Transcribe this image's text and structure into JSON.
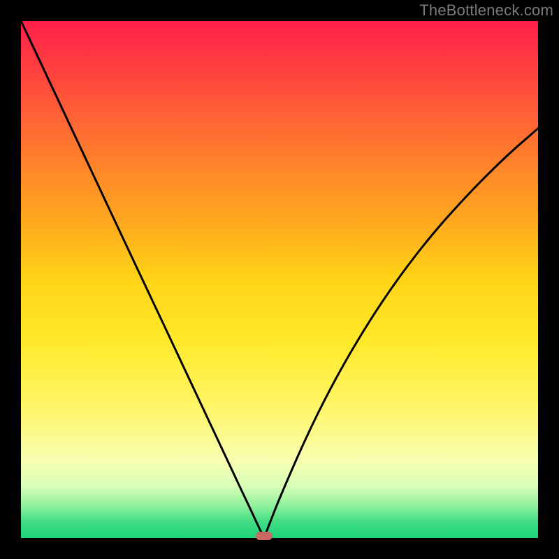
{
  "watermark": "TheBottleneck.com",
  "colors": {
    "frame": "#000000",
    "watermark": "#7b7b7b",
    "curve": "#000000",
    "marker": "#c96a64",
    "gradient_stops": [
      "#ff1f4a",
      "#ff4a3c",
      "#ff7a2e",
      "#ffa61f",
      "#ffd417",
      "#ffe92a",
      "#fff66a",
      "#f8ffb0",
      "#d8ffb8",
      "#8aef9a",
      "#3fdc84",
      "#1dd57a"
    ]
  },
  "chart_data": {
    "type": "line",
    "title": "",
    "xlabel": "",
    "ylabel": "",
    "xlim": [
      0,
      100
    ],
    "ylim": [
      0,
      100
    ],
    "x": [
      0,
      5,
      10,
      15,
      20,
      25,
      30,
      35,
      40,
      42,
      44,
      46,
      47,
      48,
      50,
      55,
      60,
      65,
      70,
      75,
      80,
      85,
      90,
      95,
      100
    ],
    "y": [
      100,
      89.4,
      78.7,
      68.1,
      57.4,
      46.8,
      36.2,
      25.5,
      14.9,
      10.6,
      6.4,
      2.1,
      0,
      2.6,
      7.7,
      19.2,
      29.3,
      38.1,
      46,
      53,
      59.3,
      64.9,
      70.1,
      74.9,
      79.2
    ],
    "min_point": {
      "x": 47,
      "y": 0
    },
    "grid": false,
    "legend": false
  }
}
